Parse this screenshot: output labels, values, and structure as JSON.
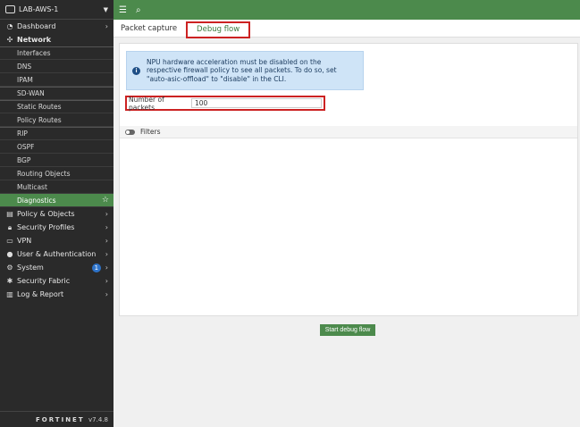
{
  "header": {
    "device": "LAB-AWS-1"
  },
  "sidebar": {
    "items": [
      {
        "label": "Dashboard",
        "icon": "dashboard-icon"
      },
      {
        "label": "Network",
        "icon": "network-icon"
      },
      {
        "label": "Policy & Objects",
        "icon": "policy-icon"
      },
      {
        "label": "Security Profiles",
        "icon": "lock-icon"
      },
      {
        "label": "VPN",
        "icon": "monitor-icon"
      },
      {
        "label": "User & Authentication",
        "icon": "user-icon"
      },
      {
        "label": "System",
        "icon": "gear-icon",
        "badge": "1"
      },
      {
        "label": "Security Fabric",
        "icon": "fabric-icon"
      },
      {
        "label": "Log & Report",
        "icon": "chart-icon"
      }
    ],
    "network_sub": [
      "Interfaces",
      "DNS",
      "IPAM",
      "SD-WAN",
      "Static Routes",
      "Policy Routes",
      "RIP",
      "OSPF",
      "BGP",
      "Routing Objects",
      "Multicast",
      "Diagnostics"
    ],
    "brand": "FORTINET",
    "version": "v7.4.8"
  },
  "tabs": {
    "packet_capture": "Packet capture",
    "debug_flow": "Debug flow"
  },
  "notice": "NPU hardware acceleration must be disabled on the respective firewall policy to see all packets. To do so, set \"auto-asic-offload\" to \"disable\" in the CLI.",
  "form": {
    "packets_label": "Number of packets",
    "packets_value": "100",
    "filters_label": "Filters"
  },
  "actions": {
    "start": "Start debug flow"
  },
  "colors": {
    "accent": "#4c8a4c",
    "highlight": "#cc2222",
    "sidebar": "#2a2a2a"
  }
}
